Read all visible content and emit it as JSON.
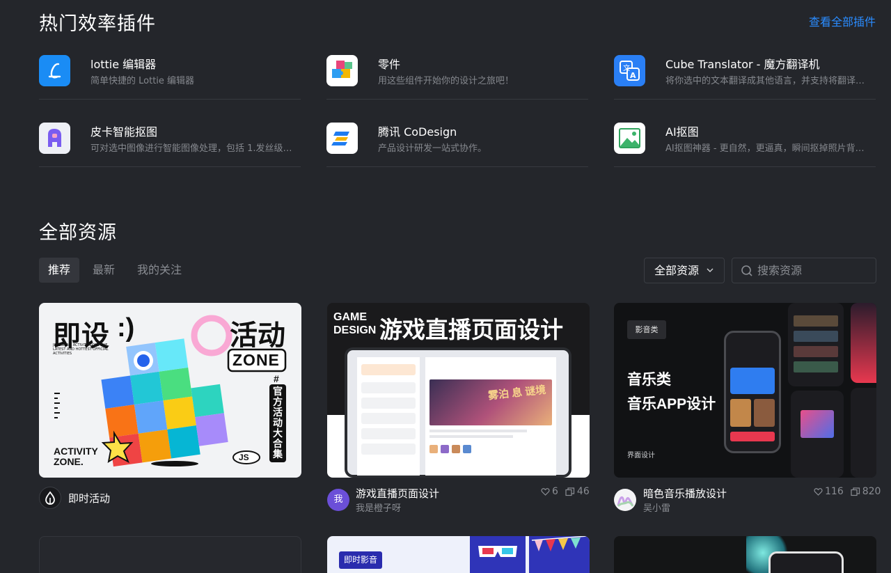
{
  "plugins_section": {
    "title": "热门效率插件",
    "view_all": "查看全部插件",
    "items": [
      {
        "name": "lottie 编辑器",
        "desc": "简单快捷的 Lottie 编辑器",
        "icon": "lottie-icon"
      },
      {
        "name": "零件",
        "desc": "用这些组件开始你的设计之旅吧！",
        "icon": "puzzle-icon"
      },
      {
        "name": "Cube Translator - 魔方翻译机",
        "desc": "将你选中的文本翻译成其他语言，并支持将翻译…",
        "icon": "translate-icon"
      },
      {
        "name": "皮卡智能抠图",
        "desc": "可对选中图像进行智能图像处理，包括 1.发丝级…",
        "icon": "picup-icon"
      },
      {
        "name": "腾讯 CoDesign",
        "desc": "产品设计研发一站式协作。",
        "icon": "codesign-icon"
      },
      {
        "name": "AI抠图",
        "desc": "AI抠图神器 - 更自然，更逼真，瞬间抠掉照片背…",
        "icon": "image-cutout-icon"
      }
    ]
  },
  "resources_section": {
    "title": "全部资源",
    "tabs": [
      "推荐",
      "最新",
      "我的关注"
    ],
    "active_tab": "推荐",
    "filter_value": "全部资源",
    "search_placeholder": "搜索资源"
  },
  "cards": [
    {
      "title": "即时活动",
      "author": "",
      "cover": {
        "l1": "即设",
        "l2": ":)",
        "l3": "活动",
        "zone": "ZONE",
        "vertical": "官方活动大合集",
        "hash": "#",
        "brand": "JS",
        "footer1": "ACTIVITY",
        "footer2": "ZONE.",
        "small": "JSDESIGN · ACTIVITY ZONE THE LATEST AND HOTTEST OFFICIAL ACTIVITIES"
      }
    },
    {
      "title": "游戏直播页面设计",
      "author": "我是橙子呀",
      "avatar_text": "我",
      "likes": "6",
      "copies": "46",
      "cover": {
        "g1": "GAME",
        "g2": "DESIGN",
        "headline": "游戏直播页面设计",
        "inner_title": "雾泊 息 谜境"
      }
    },
    {
      "title": "暗色音乐播放设计",
      "author": "吴小雷",
      "likes": "116",
      "copies": "820",
      "cover": {
        "tag": "影音类",
        "line1": "音乐类",
        "line2": "音乐APP设计",
        "footer": "界面设计"
      }
    },
    {
      "title": "",
      "author": "",
      "cover": {}
    },
    {
      "title": "",
      "author": "",
      "cover": {
        "tag": "即时影音"
      }
    },
    {
      "title": "",
      "author": "",
      "cover": {}
    }
  ],
  "colors": {
    "bg": "#24262b",
    "accent": "#2a8cff",
    "muted": "#8a8d93",
    "divider": "#373a40"
  }
}
